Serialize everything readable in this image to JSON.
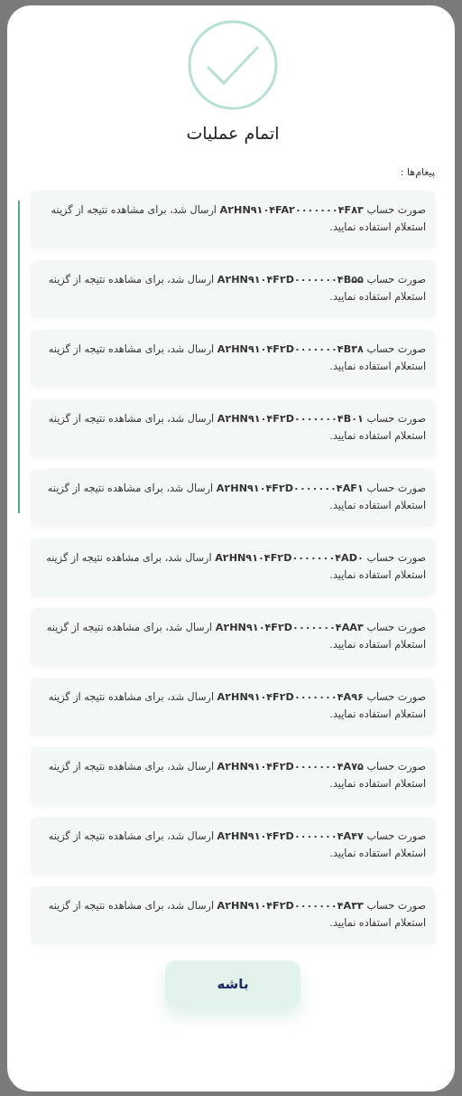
{
  "dialog": {
    "title": "اتمام عملیات",
    "messages_label": "پیغام‌ها :",
    "messages": [
      "صورت حساب **A۲HN۹۱۰۴FA۲۰۰۰۰۰۰۰۴F۸۳** ارسال شد، برای مشاهده نتیجه از گزینه استعلام استفاده نمایید.",
      "صورت حساب **A۲HN۹۱۰۴F۲D۰۰۰۰۰۰۰۴B۵۵** ارسال شد، برای مشاهده نتیجه از گزینه استعلام استفاده نمایید.",
      "صورت حساب **A۲HN۹۱۰۴F۲D۰۰۰۰۰۰۰۴B۳۸** ارسال شد، برای مشاهده نتیجه از گزینه استعلام استفاده نمایید.",
      "صورت حساب **A۲HN۹۱۰۴F۲D۰۰۰۰۰۰۰۴B۰۱** ارسال شد، برای مشاهده نتیجه از گزینه استعلام استفاده نمایید.",
      "صورت حساب **A۲HN۹۱۰۴F۲D۰۰۰۰۰۰۰۴AF۱** ارسال شد، برای مشاهده نتیجه از گزینه استعلام استفاده نمایید.",
      "صورت حساب **A۲HN۹۱۰۴F۲D۰۰۰۰۰۰۰۴AD۰** ارسال شد، برای مشاهده نتیجه از گزینه استعلام استفاده نمایید.",
      "صورت حساب **A۲HN۹۱۰۴F۲D۰۰۰۰۰۰۰۴AA۳** ارسال شد، برای مشاهده نتیجه از گزینه استعلام استفاده نمایید.",
      "صورت حساب **A۲HN۹۱۰۴F۲D۰۰۰۰۰۰۰۴A۹۶** ارسال شد، برای مشاهده نتیجه از گزینه استعلام استفاده نمایید.",
      "صورت حساب **A۲HN۹۱۰۴F۲D۰۰۰۰۰۰۰۴A۷۵** ارسال شد، برای مشاهده نتیجه از گزینه استعلام استفاده نمایید.",
      "صورت حساب **A۲HN۹۱۰۴F۲D۰۰۰۰۰۰۰۴A۴۷** ارسال شد، برای مشاهده نتیجه از گزینه استعلام استفاده نمایید.",
      "صورت حساب **A۲HN۹۱۰۴F۲D۰۰۰۰۰۰۰۴A۳۳** ارسال شد، برای مشاهده نتیجه از گزینه استعلام استفاده نمایید."
    ],
    "button": "باشه"
  }
}
